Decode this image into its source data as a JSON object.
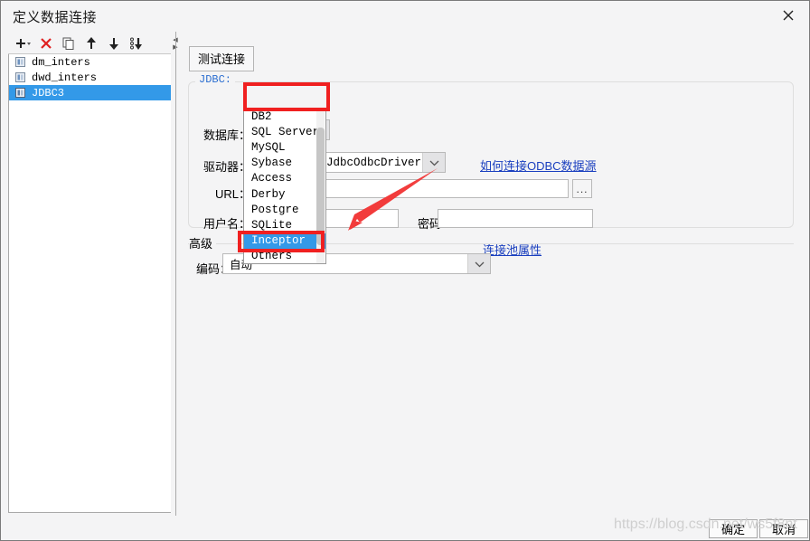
{
  "window": {
    "title": "定义数据连接",
    "close_icon": "close-icon"
  },
  "toolbar": {
    "icons": [
      {
        "name": "add-icon",
        "label": "+"
      },
      {
        "name": "delete-icon",
        "label": "✕"
      },
      {
        "name": "copy-icon",
        "label": "copy"
      },
      {
        "name": "move-up-icon",
        "label": "↑"
      },
      {
        "name": "move-down-icon",
        "label": "↓"
      },
      {
        "name": "sort-icon",
        "label": "sort"
      }
    ]
  },
  "tree": {
    "items": [
      {
        "label": "dm_inters",
        "selected": false
      },
      {
        "label": "dwd_inters",
        "selected": false
      },
      {
        "label": "JDBC3",
        "selected": true
      }
    ]
  },
  "main": {
    "test_button": "测试连接",
    "group_legend": "JDBC:",
    "labels": {
      "database": "数据库：",
      "driver": "驱动器：",
      "url": "URL：",
      "username": "用户名：",
      "password": "密码：",
      "advanced": "高级",
      "encoding": "编码："
    },
    "values": {
      "database": "Others",
      "driver": "JdbcOdbcDriver",
      "url": "",
      "username": "",
      "password": "",
      "encoding": "自动"
    },
    "dots_button": "...",
    "links": {
      "odbc_help": "如何连接ODBC数据源",
      "pool_props": "连接池属性"
    }
  },
  "dropdown": {
    "open": true,
    "options": [
      {
        "label": "DB2",
        "selected": false
      },
      {
        "label": "SQL Server",
        "selected": false
      },
      {
        "label": "MySQL",
        "selected": false
      },
      {
        "label": "Sybase",
        "selected": false
      },
      {
        "label": "Access",
        "selected": false
      },
      {
        "label": "Derby",
        "selected": false
      },
      {
        "label": "Postgre",
        "selected": false
      },
      {
        "label": "SQLite",
        "selected": false
      },
      {
        "label": "Inceptor",
        "selected": true
      },
      {
        "label": "Others",
        "selected": false
      }
    ]
  },
  "footer": {
    "ok": "确定",
    "cancel": "取消",
    "watermark": "https://blog.csdn.net/ws5f8nt"
  },
  "colors": {
    "annotation_red": "#f02020",
    "selection_blue": "#3399e8",
    "link_blue": "#1a3fbf",
    "legend_blue": "#2a6dd0"
  }
}
